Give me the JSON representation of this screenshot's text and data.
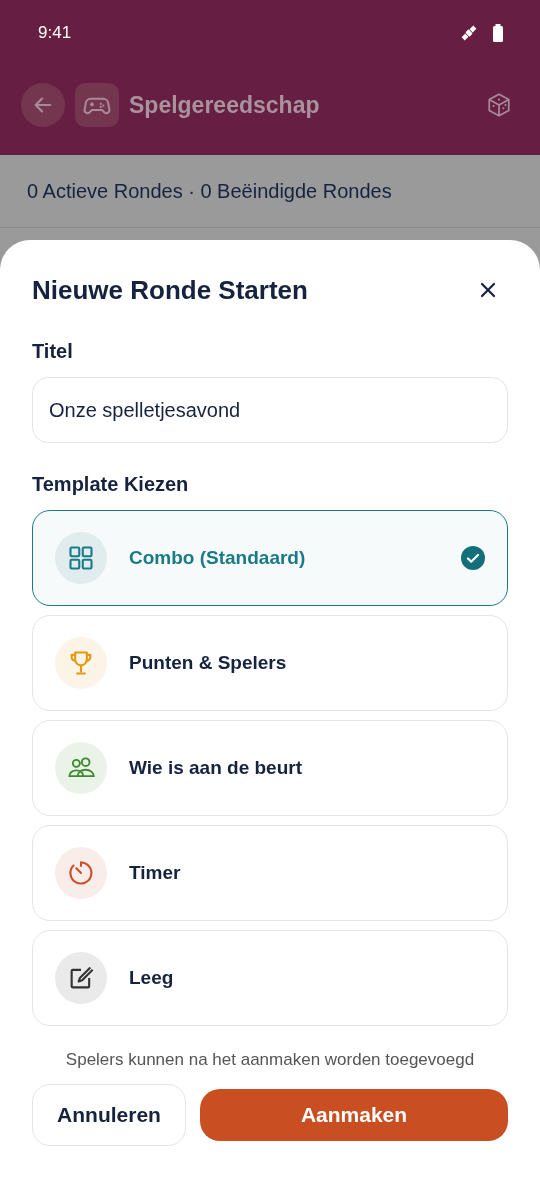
{
  "status_bar": {
    "time": "9:41"
  },
  "header": {
    "title": "Spelgereedschap"
  },
  "summary": "0 Actieve Rondes · 0 Beëindigde Rondes",
  "sheet": {
    "title": "Nieuwe Ronde Starten",
    "title_field": {
      "label": "Titel",
      "value": "Onze spelletjesavond"
    },
    "templates_label": "Template Kiezen",
    "templates": [
      {
        "kind": "grid",
        "label": "Combo (Standaard)",
        "color": "#1a7a86",
        "selected": true
      },
      {
        "kind": "trophy",
        "label": "Punten & Spelers",
        "color": "#e39a12",
        "selected": false
      },
      {
        "kind": "people",
        "label": "Wie is aan de beurt",
        "color": "#3a8a2a",
        "selected": false
      },
      {
        "kind": "timer",
        "label": "Timer",
        "color": "#c9502a",
        "selected": false
      },
      {
        "kind": "edit",
        "label": "Leeg",
        "color": "#333333",
        "selected": false
      }
    ],
    "hint": "Spelers kunnen na het aanmaken worden toegevoegd",
    "buttons": {
      "cancel": "Annuleren",
      "create": "Aanmaken"
    }
  }
}
